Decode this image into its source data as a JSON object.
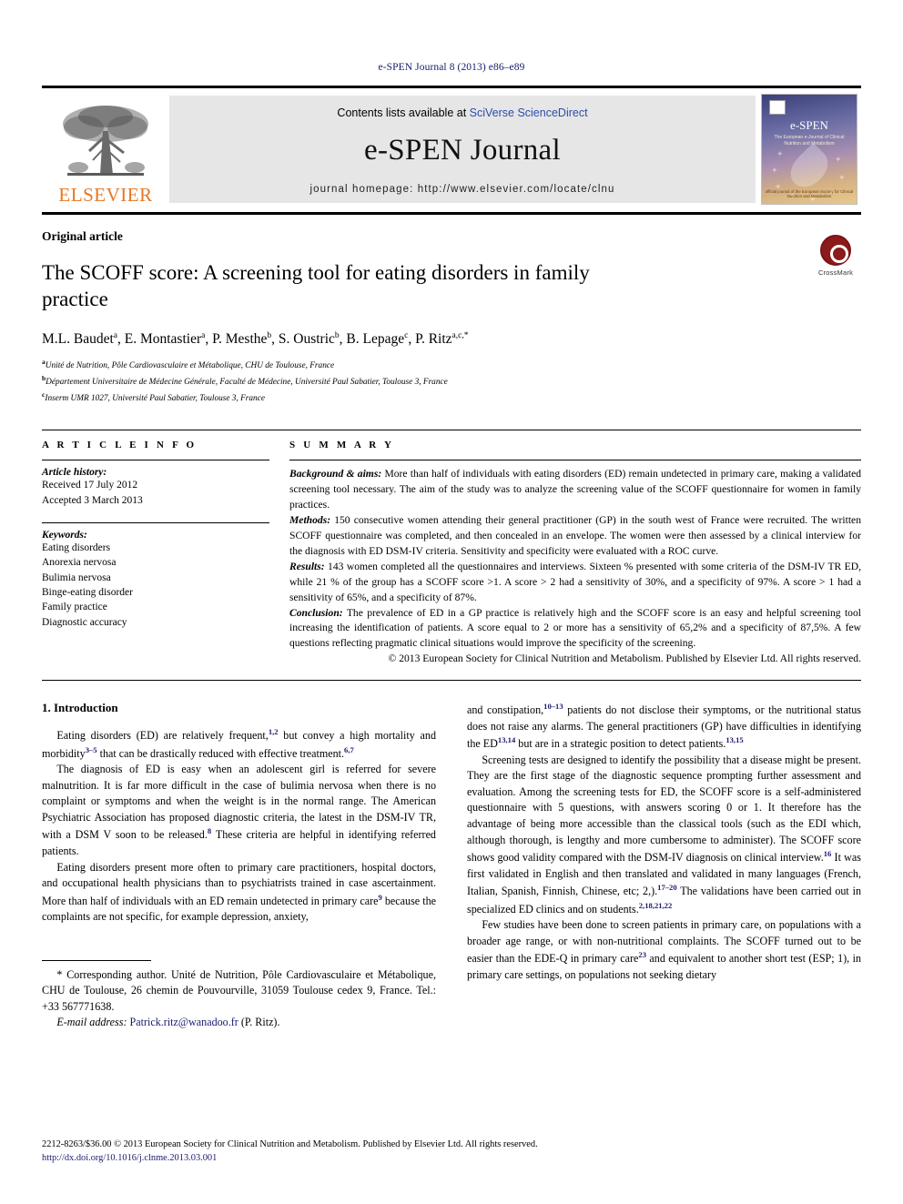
{
  "running_head": "e-SPEN Journal 8 (2013) e86–e89",
  "masthead": {
    "publisher": "ELSEVIER",
    "contents_prefix": "Contents lists available at ",
    "contents_link": "SciVerse ScienceDirect",
    "journal_name": "e-SPEN Journal",
    "homepage_label": "journal homepage:",
    "homepage_url": "http://www.elsevier.com/locate/clnu",
    "cover": {
      "title": "e-SPEN",
      "subtitle": "The European e-Journal of Clinical Nutrition and Metabolism",
      "footer": "official journal of the European Society for Clinical Nutrition and Metabolism"
    }
  },
  "article": {
    "kicker": "Original article",
    "title": "The SCOFF score: A screening tool for eating disorders in family practice",
    "authors": "M.L. Baudet a, E. Montastier a, P. Mesthe b, S. Oustric b, B. Lepage c, P. Ritz a,c,*",
    "author_list": [
      {
        "name": "M.L. Baudet",
        "marks": "a"
      },
      {
        "name": "E. Montastier",
        "marks": "a"
      },
      {
        "name": "P. Mesthe",
        "marks": "b"
      },
      {
        "name": "S. Oustric",
        "marks": "b"
      },
      {
        "name": "B. Lepage",
        "marks": "c"
      },
      {
        "name": "P. Ritz",
        "marks": "a,c,*"
      }
    ],
    "affiliations": [
      {
        "mark": "a",
        "text": "Unité de Nutrition, Pôle Cardiovasculaire et Métabolique, CHU de Toulouse, France"
      },
      {
        "mark": "b",
        "text": "Département Universitaire de Médecine Générale, Faculté de Médecine, Université Paul Sabatier, Toulouse 3, France"
      },
      {
        "mark": "c",
        "text": "Inserm UMR 1027, Université Paul Sabatier, Toulouse 3, France"
      }
    ],
    "crossmark_label": "CrossMark"
  },
  "info": {
    "heading": "A R T I C L E  I N F O",
    "history_title": "Article history:",
    "history": [
      "Received 17 July 2012",
      "Accepted 3 March 2013"
    ],
    "keywords_title": "Keywords:",
    "keywords": [
      "Eating disorders",
      "Anorexia nervosa",
      "Bulimia nervosa",
      "Binge-eating disorder",
      "Family practice",
      "Diagnostic accuracy"
    ]
  },
  "summary": {
    "heading": "S U M M A R Y",
    "sections": [
      {
        "lead": "Background & aims:",
        "text": " More than half of individuals with eating disorders (ED) remain undetected in primary care, making a validated screening tool necessary. The aim of the study was to analyze the screening value of the SCOFF questionnaire for women in family practices."
      },
      {
        "lead": "Methods:",
        "text": " 150 consecutive women attending their general practitioner (GP) in the south west of France were recruited. The written SCOFF questionnaire was completed, and then concealed in an envelope. The women were then assessed by a clinical interview for the diagnosis with ED DSM-IV criteria. Sensitivity and specificity were evaluated with a ROC curve."
      },
      {
        "lead": "Results:",
        "text": " 143 women completed all the questionnaires and interviews. Sixteen % presented with some criteria of the DSM-IV TR ED, while 21 % of the group has a SCOFF score >1. A score > 2 had a sensitivity of 30%, and a specificity of 97%. A score > 1 had a sensitivity of 65%, and a specificity of 87%."
      },
      {
        "lead": "Conclusion:",
        "text": " The prevalence of ED in a GP practice is relatively high and the SCOFF score is an easy and helpful screening tool increasing the identification of patients. A score equal to 2 or more has a sensitivity of 65,2% and a specificity of 87,5%. A few questions reflecting pragmatic clinical situations would improve the specificity of the screening."
      }
    ],
    "copyright": "© 2013 European Society for Clinical Nutrition and Metabolism. Published by Elsevier Ltd. All rights reserved."
  },
  "body": {
    "section_heading": "1. Introduction",
    "left_paragraphs": [
      "Eating disorders (ED) are relatively frequent,1,2 but convey a high mortality and morbidity3–5 that can be drastically reduced with effective treatment.6,7",
      "The diagnosis of ED is easy when an adolescent girl is referred for severe malnutrition. It is far more difficult in the case of bulimia nervosa when there is no complaint or symptoms and when the weight is in the normal range. The American Psychiatric Association has proposed diagnostic criteria, the latest in the DSM-IV TR, with a DSM V soon to be released.8 These criteria are helpful in identifying referred patients.",
      "Eating disorders present more often to primary care practitioners, hospital doctors, and occupational health physicians than to psychiatrists trained in case ascertainment. More than half of individuals with an ED remain undetected in primary care9 because the complaints are not specific, for example depression, anxiety,"
    ],
    "right_paragraphs": [
      "and constipation,10–13 patients do not disclose their symptoms, or the nutritional status does not raise any alarms. The general practitioners (GP) have difficulties in identifying the ED13,14 but are in a strategic position to detect patients.13,15",
      "Screening tests are designed to identify the possibility that a disease might be present. They are the first stage of the diagnostic sequence prompting further assessment and evaluation. Among the screening tests for ED, the SCOFF score is a self-administered questionnaire with 5 questions, with answers scoring 0 or 1. It therefore has the advantage of being more accessible than the classical tools (such as the EDI which, although thorough, is lengthy and more cumbersome to administer). The SCOFF score shows good validity compared with the DSM-IV diagnosis on clinical interview.16 It was first validated in English and then translated and validated in many languages (French, Italian, Spanish, Finnish, Chinese, etc; 2,).17–20 The validations have been carried out in specialized ED clinics and on students.2,18,21,22",
      "Few studies have been done to screen patients in primary care, on populations with a broader age range, or with non-nutritional complaints. The SCOFF turned out to be easier than the EDE-Q in primary care23 and equivalent to another short test (ESP; 1), in primary care settings, on populations not seeking dietary"
    ]
  },
  "footnote": {
    "corresponding": "* Corresponding author. Unité de Nutrition, Pôle Cardiovasculaire et Métabolique, CHU de Toulouse, 26 chemin de Pouvourville, 31059 Toulouse cedex 9, France. Tel.: +33 567771638.",
    "email_label": "E-mail address:",
    "email": "Patrick.ritz@wanadoo.fr",
    "email_suffix": " (P. Ritz)."
  },
  "page_footer": {
    "issn_line": "2212-8263/$36.00 © 2013 European Society for Clinical Nutrition and Metabolism. Published by Elsevier Ltd. All rights reserved.",
    "doi": "http://dx.doi.org/10.1016/j.clnme.2013.03.001"
  }
}
